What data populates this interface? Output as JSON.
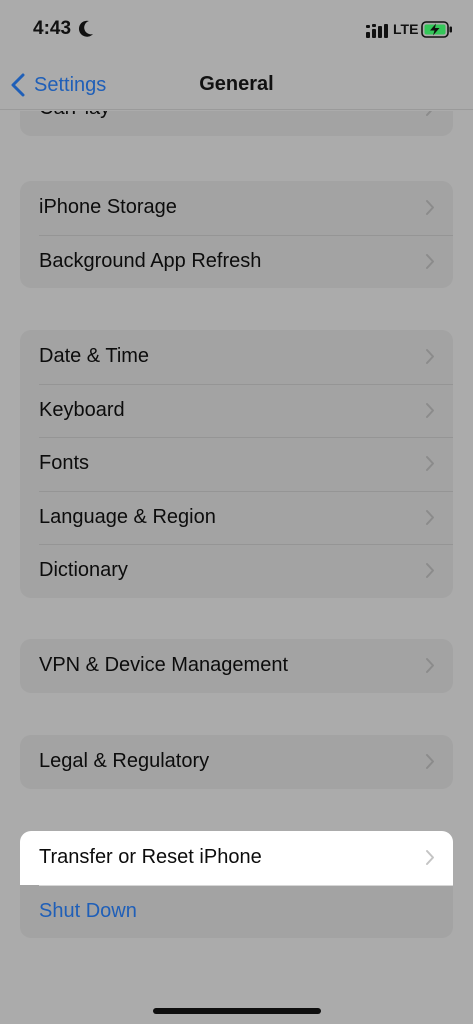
{
  "status_bar": {
    "time": "4:43",
    "network": "LTE"
  },
  "nav": {
    "back_label": "Settings",
    "title": "General"
  },
  "colors": {
    "accent": "#1f5fb8",
    "background": "#ababab",
    "group_bg": "#a3a3a3",
    "battery_charging": "#34c759"
  },
  "groups": [
    {
      "items": [
        {
          "label": "CarPlay"
        }
      ]
    },
    {
      "items": [
        {
          "label": "iPhone Storage"
        },
        {
          "label": "Background App Refresh"
        }
      ]
    },
    {
      "items": [
        {
          "label": "Date & Time"
        },
        {
          "label": "Keyboard"
        },
        {
          "label": "Fonts"
        },
        {
          "label": "Language & Region"
        },
        {
          "label": "Dictionary"
        }
      ]
    },
    {
      "items": [
        {
          "label": "VPN & Device Management"
        }
      ]
    },
    {
      "items": [
        {
          "label": "Legal & Regulatory"
        }
      ]
    },
    {
      "items": [
        {
          "label": "Transfer or Reset iPhone"
        },
        {
          "label": "Shut Down"
        }
      ]
    }
  ]
}
